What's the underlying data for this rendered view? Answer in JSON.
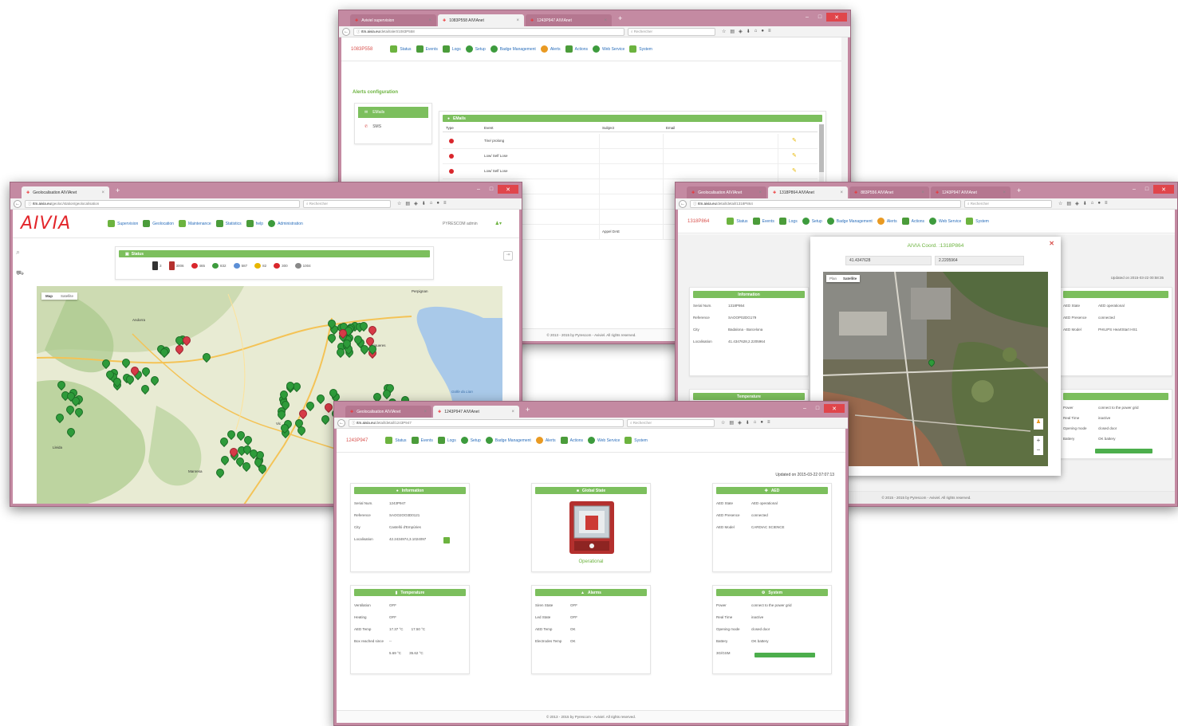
{
  "browser": {
    "search_placeholder": "Rechercher",
    "toolbar_icons": [
      "star-icon",
      "reader-icon",
      "pocket-icon",
      "download-icon",
      "home-icon",
      "chat-icon",
      "menu-icon"
    ]
  },
  "win_alerts": {
    "tabs": [
      "Aviviel supervision",
      "1083P558 AIVIAnet",
      "1243P947 AIVIAnet"
    ],
    "url_host": "rtm.aivia.eu",
    "url_path": "/detail/alert/1083P558",
    "device_id": "1083P558",
    "menu": [
      "Status",
      "Events",
      "Logs",
      "Setup",
      "Badge Management",
      "Alerts",
      "Actions",
      "Web Service",
      "System"
    ],
    "section_title": "Alerts configuration",
    "side_items": [
      "EMails",
      "SMS"
    ],
    "table_title": "EMails",
    "columns": [
      "Type",
      "Event",
      "Subject",
      "Email"
    ],
    "rows": [
      "Tire/ prolong",
      "Low/ Self Lose",
      "Low/ Self Lose",
      "…ture alert",
      "…",
      "…ture alert",
      "…emperature"
    ],
    "row_extra_subject": "Appel DAE",
    "footer": "© 2013 - 2015 by Pyrescom - Aviviel. All rights reserved."
  },
  "win_geo": {
    "tabs": [
      "Geolocalisation AIVIAnet"
    ],
    "url_host": "rtm.aivia.eu",
    "url_path": "/geoloc/station/geolocalisation",
    "brand": "AIVIA",
    "menu": [
      "Supervision",
      "Geolocation",
      "Maintenance",
      "Statistics",
      "help",
      "Administration"
    ],
    "user": "PYRESCOM admin",
    "status_title": "Status",
    "status_counts": [
      "3",
      "3006",
      "465",
      "832",
      "587",
      "82",
      "300",
      "1004"
    ],
    "map_types": [
      "Map",
      "Satellite"
    ],
    "places": [
      "Perpignan",
      "Figueres",
      "Girona",
      "Golfe du Lion",
      "Andorra",
      "Manresa",
      "Vic",
      "Lleida"
    ]
  },
  "win_sat": {
    "tabs": [
      "Geolocalisation AIVIAnet",
      "1318P864 AIVIAnet",
      "883P556 AIVIAnet",
      "1243P947 AIVIAnet"
    ],
    "url_host": "rtm.aivia.eu",
    "url_path": "/detail/detail/1318P864",
    "device_id": "1318P864",
    "menu": [
      "Status",
      "Events",
      "Logs",
      "Setup",
      "Badge Management",
      "Alerts",
      "Actions",
      "Web Service",
      "System"
    ],
    "popup_title": "AIVIA Coord. :1318P864",
    "coord_lat": "41.4347628",
    "coord_lon": "2.2205964",
    "map_types": [
      "Plan",
      "Satellite"
    ],
    "updated": "Updated on 2015-03-22 00:58:35",
    "info_title": "Information",
    "info_rows": [
      [
        "Serial Num.",
        "1318P864"
      ],
      [
        "Reference",
        "SAOOP02DG179"
      ],
      [
        "City",
        "Badalona - Barcelona"
      ],
      [
        "Localisation",
        "41.4347628,2.2205964"
      ]
    ],
    "aed_rows": [
      [
        "AED State",
        "AED operational"
      ],
      [
        "AED Presence",
        "connected"
      ],
      [
        "AED Model",
        "PHILIPS HeartStart HS1"
      ]
    ],
    "temp_title": "Temperature",
    "temp_rows": [
      [
        "Ventilation",
        "OFF"
      ],
      [
        "Heating",
        "OFF"
      ]
    ],
    "sys_rows": [
      [
        "Power",
        "connect to the power grid"
      ],
      [
        "Real Time",
        "inactive"
      ],
      [
        "Opening mode",
        "closed door"
      ],
      [
        "Battery",
        "OK battery"
      ]
    ],
    "footer": "© 2015 - 2015 by Pyrescom - Aviviel. All rights reserved."
  },
  "win_detail": {
    "tabs": [
      "Geolocalisation AIVIAnet",
      "1243P947 AIVIAnet"
    ],
    "url_host": "rtm.aivia.eu",
    "url_path": "/detail/detail/1243P947",
    "device_id": "1243P947",
    "menu": [
      "Status",
      "Events",
      "Logs",
      "Setup",
      "Badge Management",
      "Alerts",
      "Actions",
      "Web Service",
      "System"
    ],
    "updated": "Updated on 2015-03-22 07:07:13",
    "info_title": "Information",
    "info_rows": [
      [
        "Serial Num.",
        "1243P947"
      ],
      [
        "Reference",
        "SAOO2OO3D0121"
      ],
      [
        "City",
        "Castelló d'Empúries"
      ],
      [
        "Localisation",
        "42.2434974,3.1024097"
      ]
    ],
    "global_title": "Global State",
    "global_status": "Operational",
    "aed_title": "AED",
    "aed_rows": [
      [
        "AED State",
        "AED operational"
      ],
      [
        "AED Presence",
        "connected"
      ],
      [
        "AED Model",
        "CARDIAC SCIENCE"
      ]
    ],
    "temp_title": "Temperature",
    "temp_rows": [
      [
        "Ventilation",
        "OFF",
        ""
      ],
      [
        "Heating",
        "OFF",
        ""
      ],
      [
        "AED Temp",
        "17.37 °C",
        "17.50 °C"
      ],
      [
        "Box reached since",
        "--",
        ""
      ],
      [
        "",
        "5.69 °C",
        "35.62 °C"
      ]
    ],
    "alarm_title": "Alarms",
    "alarm_rows": [
      [
        "Siren State",
        "OFF"
      ],
      [
        "Led State",
        "OFF"
      ],
      [
        "AED Temp",
        "OK"
      ],
      [
        "Electrodes Temp",
        "OK"
      ]
    ],
    "sys_title": "System",
    "sys_rows": [
      [
        "Power",
        "connect to the power grid"
      ],
      [
        "Real Time",
        "inactive"
      ],
      [
        "Opening mode",
        "closed door"
      ],
      [
        "Battery",
        "OK battery"
      ],
      [
        "3G/GSM",
        ""
      ]
    ],
    "footer": "© 2013 - 2015 by Pyrescom - Aviviel. All rights reserved."
  },
  "colors": {
    "frame": "#c48aa2",
    "green": "#7cbf5d",
    "link": "#2a6ebb",
    "brand_red": "#e3262b"
  }
}
